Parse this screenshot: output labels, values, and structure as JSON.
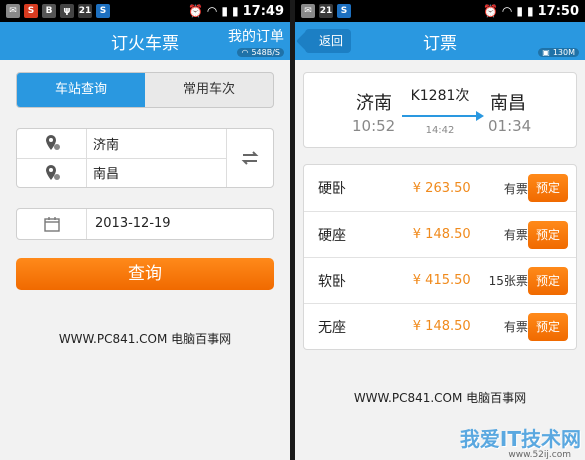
{
  "left": {
    "status": {
      "time": "17:49"
    },
    "title": "订火车票",
    "orders_label": "我的订单",
    "net_speed": "548B/S",
    "tabs": [
      "车站查询",
      "常用车次"
    ],
    "from_station": "济南",
    "to_station": "南昌",
    "date": "2013-12-19",
    "query_label": "查询",
    "watermark": "WWW.PC841.COM 电脑百事网"
  },
  "right": {
    "status": {
      "time": "17:50"
    },
    "back_label": "返回",
    "title": "订票",
    "memory": "130M",
    "route": {
      "from_city": "济南",
      "to_city": "南昌",
      "depart_time": "10:52",
      "arrive_time": "01:34",
      "train_no": "K1281次",
      "duration": "14:42"
    },
    "seats": [
      {
        "type": "硬卧",
        "price": "¥ 263.50",
        "avail": "有票",
        "action": "预定"
      },
      {
        "type": "硬座",
        "price": "¥ 148.50",
        "avail": "有票",
        "action": "预定"
      },
      {
        "type": "软卧",
        "price": "¥ 415.50",
        "avail": "15张票",
        "action": "预定"
      },
      {
        "type": "无座",
        "price": "¥ 148.50",
        "avail": "有票",
        "action": "预定"
      }
    ],
    "watermark": "WWW.PC841.COM 电脑百事网",
    "site_logo": "我爱IT技术网",
    "site_url": "www.52ij.com"
  },
  "colors": {
    "accent": "#2a98e0",
    "orange": "#f07a10"
  }
}
